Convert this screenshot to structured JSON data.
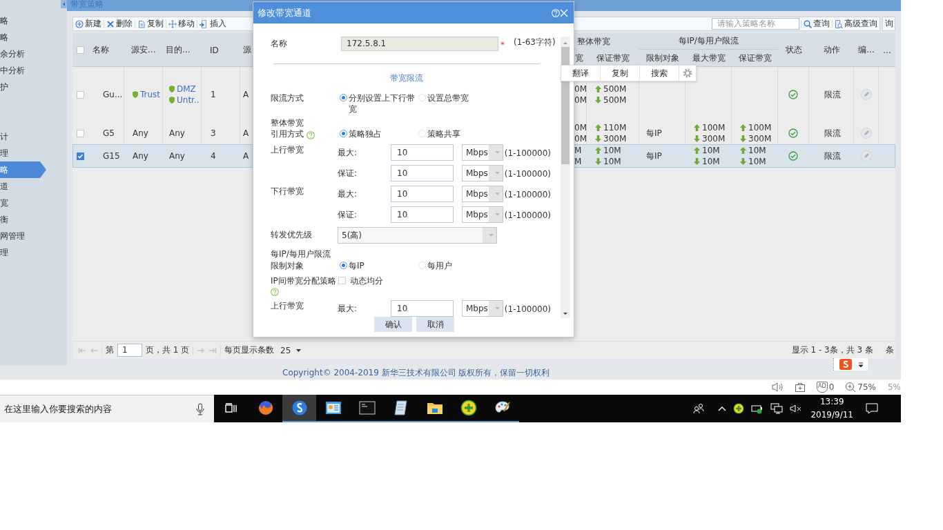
{
  "app": {
    "title": "带宽策略"
  },
  "sidebar": {
    "items": [
      {
        "label": "略",
        "selected": false
      },
      {
        "label": "略",
        "selected": false
      },
      {
        "label": "余分析",
        "selected": false
      },
      {
        "label": "中分析",
        "selected": false
      },
      {
        "label": "护",
        "selected": false
      },
      {
        "label": "计",
        "selected": false
      },
      {
        "label": "理",
        "selected": false
      },
      {
        "label": "略",
        "selected": true
      },
      {
        "label": "道",
        "selected": false
      },
      {
        "label": "宽",
        "selected": false
      },
      {
        "label": "衡",
        "selected": false
      },
      {
        "label": "网管理",
        "selected": false
      },
      {
        "label": "理",
        "selected": false
      }
    ]
  },
  "toolbar": {
    "buttons": [
      "新建",
      "删除",
      "复制",
      "移动",
      "插入"
    ],
    "search_placeholder": "请输入策略名称",
    "query": "查询",
    "advanced_query": "高级查询",
    "edge_button": "询"
  },
  "table": {
    "header_checked": false,
    "columns_left": [
      "名称",
      "源安...",
      "目的...",
      "ID",
      "源"
    ],
    "group_headers": [
      "整体带宽",
      "每IP/每用户限流"
    ],
    "columns_right": [
      "宽",
      "保证带宽",
      "限制对象",
      "最大带宽",
      "保证带宽",
      "状态",
      "动作",
      "编...",
      "..."
    ],
    "rows": [
      {
        "checked": false,
        "selected": false,
        "name": "Gu...",
        "source": [
          {
            "kind": "zone",
            "label": "Trust"
          }
        ],
        "destination": [
          {
            "kind": "zone",
            "label": "DMZ"
          },
          {
            "kind": "zone",
            "label": "Untr.."
          }
        ],
        "id": "1",
        "column_6": "A",
        "total_max": {
          "up": "0M",
          "down": "0M"
        },
        "total_guaranteed": {
          "up": "500M",
          "down": "500M"
        },
        "enabled": true,
        "action": "限流"
      },
      {
        "checked": false,
        "selected": false,
        "name": "G5",
        "source": [
          {
            "kind": "any",
            "label": "Any"
          }
        ],
        "destination": [
          {
            "kind": "any",
            "label": "Any"
          }
        ],
        "id": "3",
        "column_6": "A",
        "total_max": {
          "up": "0M",
          "down": "0M"
        },
        "total_guaranteed": {
          "up": "110M",
          "down": "300M"
        },
        "limit_target": "每IP",
        "ip_max": {
          "up": "100M",
          "down": "300M"
        },
        "ip_guaranteed": {
          "up": "100M",
          "down": "300M"
        },
        "enabled": true,
        "action": "限流"
      },
      {
        "checked": true,
        "selected": true,
        "name": "G15",
        "source": [
          {
            "kind": "any",
            "label": "Any"
          }
        ],
        "destination": [
          {
            "kind": "any",
            "label": "Any"
          }
        ],
        "id": "4",
        "column_6": "A",
        "total_max": {
          "up": "M",
          "down": "M"
        },
        "total_guaranteed": {
          "up": "10M",
          "down": "10M"
        },
        "limit_target": "每IP",
        "ip_max": {
          "up": "10M",
          "down": "10M"
        },
        "ip_guaranteed": {
          "up": "10M",
          "down": "10M"
        },
        "enabled": true,
        "action": "限流"
      }
    ]
  },
  "pager": {
    "page_prefix": "第",
    "page": "1",
    "page_suffix": "页，共 1 页",
    "page_size_label": "每页显示条数",
    "page_size": "25",
    "info": "显示 1 - 3条，共 3 条",
    "edge_text": "条"
  },
  "footer": {
    "copyright": "Copyright© 2004-2019 新华三技术有限公司 版权所有，保留一切权利"
  },
  "context_popup": {
    "items": [
      "翻译",
      "复制",
      "搜索"
    ]
  },
  "browser_status": {
    "ad_label": "AD",
    "ad_count": "0",
    "zoom": "75%",
    "edge_text": "5%"
  },
  "dialog": {
    "title": "修改带宽通道",
    "name_field": {
      "label": "名称",
      "value": "172.5.8.1",
      "required_mark": "*",
      "hint": "(1-63字符)"
    },
    "section_title": "带宽限流",
    "limit_mode": {
      "label": "限流方式",
      "options": [
        {
          "label": "分别设置上下行带宽",
          "selected": true
        },
        {
          "label": "设置总带宽",
          "selected": false
        }
      ]
    },
    "reference_mode": {
      "label": "整体带宽引用方式",
      "options": [
        {
          "label": "策略独占",
          "selected": true
        },
        {
          "label": "策略共享",
          "selected": false
        }
      ]
    },
    "overall_bandwidth": [
      {
        "label": "上行带宽",
        "rows": [
          {
            "label": "最大:",
            "value": "10",
            "unit": "Mbps",
            "hint": "(1-100000)"
          },
          {
            "label": "保证:",
            "value": "10",
            "unit": "Mbps",
            "hint": "(1-100000)"
          }
        ]
      },
      {
        "label": "下行带宽",
        "rows": [
          {
            "label": "最大:",
            "value": "10",
            "unit": "Mbps",
            "hint": "(1-100000)"
          },
          {
            "label": "保证:",
            "value": "10",
            "unit": "Mbps",
            "hint": "(1-100000)"
          }
        ]
      }
    ],
    "priority": {
      "label": "转发优先级",
      "value": "5(高)"
    },
    "per_ip_title": "每IP/每用户限流",
    "limit_target": {
      "label": "限制对象",
      "options": [
        {
          "label": "每IP",
          "selected": true
        },
        {
          "label": "每用户",
          "selected": false
        }
      ]
    },
    "ip_allocation": {
      "label": "IP间带宽分配策略",
      "option": {
        "label": "动态均分",
        "checked": false
      }
    },
    "per_ip_bandwidth": [
      {
        "label": "上行带宽",
        "rows": [
          {
            "label": "最大:",
            "value": "10",
            "unit": "Mbps",
            "hint": "(1-100000)"
          }
        ]
      }
    ],
    "buttons": [
      "确认",
      "取消"
    ]
  },
  "taskbar": {
    "search_placeholder": "在这里输入你要搜索的内容",
    "apps": [
      {
        "running": false,
        "selected": false
      },
      {
        "running": true,
        "selected": true
      },
      {
        "running": true,
        "selected": false
      },
      {
        "running": true,
        "selected": false
      },
      {
        "running": true,
        "selected": false
      },
      {
        "running": true,
        "selected": false
      },
      {
        "running": true,
        "selected": false
      },
      {
        "running": true,
        "selected": false
      }
    ],
    "time": "13:39",
    "date": "2019/9/11"
  }
}
